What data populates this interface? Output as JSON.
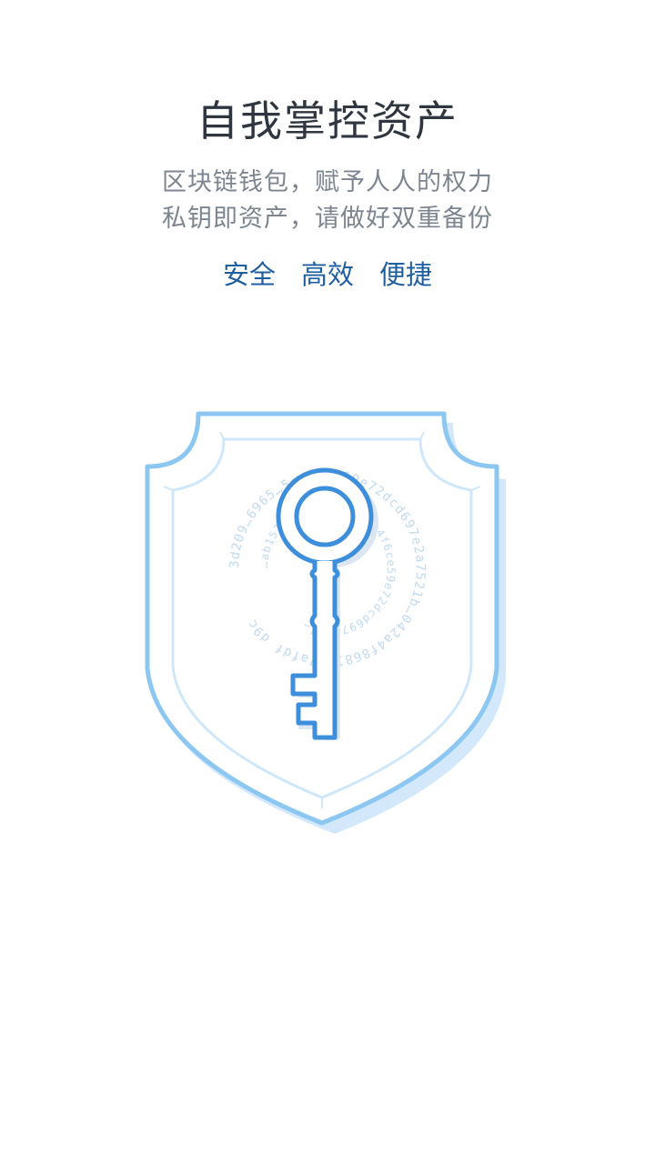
{
  "title": "自我掌控资产",
  "subtitle": {
    "line1": "区块链钱包，赋予人人的权力",
    "line2": "私钥即资产，请做好双重备份"
  },
  "features": [
    "安全",
    "高效",
    "便捷"
  ],
  "illustration": {
    "icon": "shield-key-icon",
    "ring_outer_text": "3d209…6965…5cedcae59e72dcd697e2a7521b…042a4f86815 7afdf d9c",
    "ring_inner_text": "…ab157…e0d0a2a69659 4f6ce59e72dcd697e2a7…",
    "colors": {
      "shield_outer": "#8cc7f2",
      "shield_inner": "#cfe7fa",
      "shield_shadow": "#d3e8fb",
      "key": "#3d8edb",
      "key_shadow": "#dbe6f2",
      "ring_text": "#c2daf0"
    }
  },
  "colors": {
    "title": "#2f3640",
    "subtitle": "#7d8590",
    "features": "#1f5fa0"
  }
}
